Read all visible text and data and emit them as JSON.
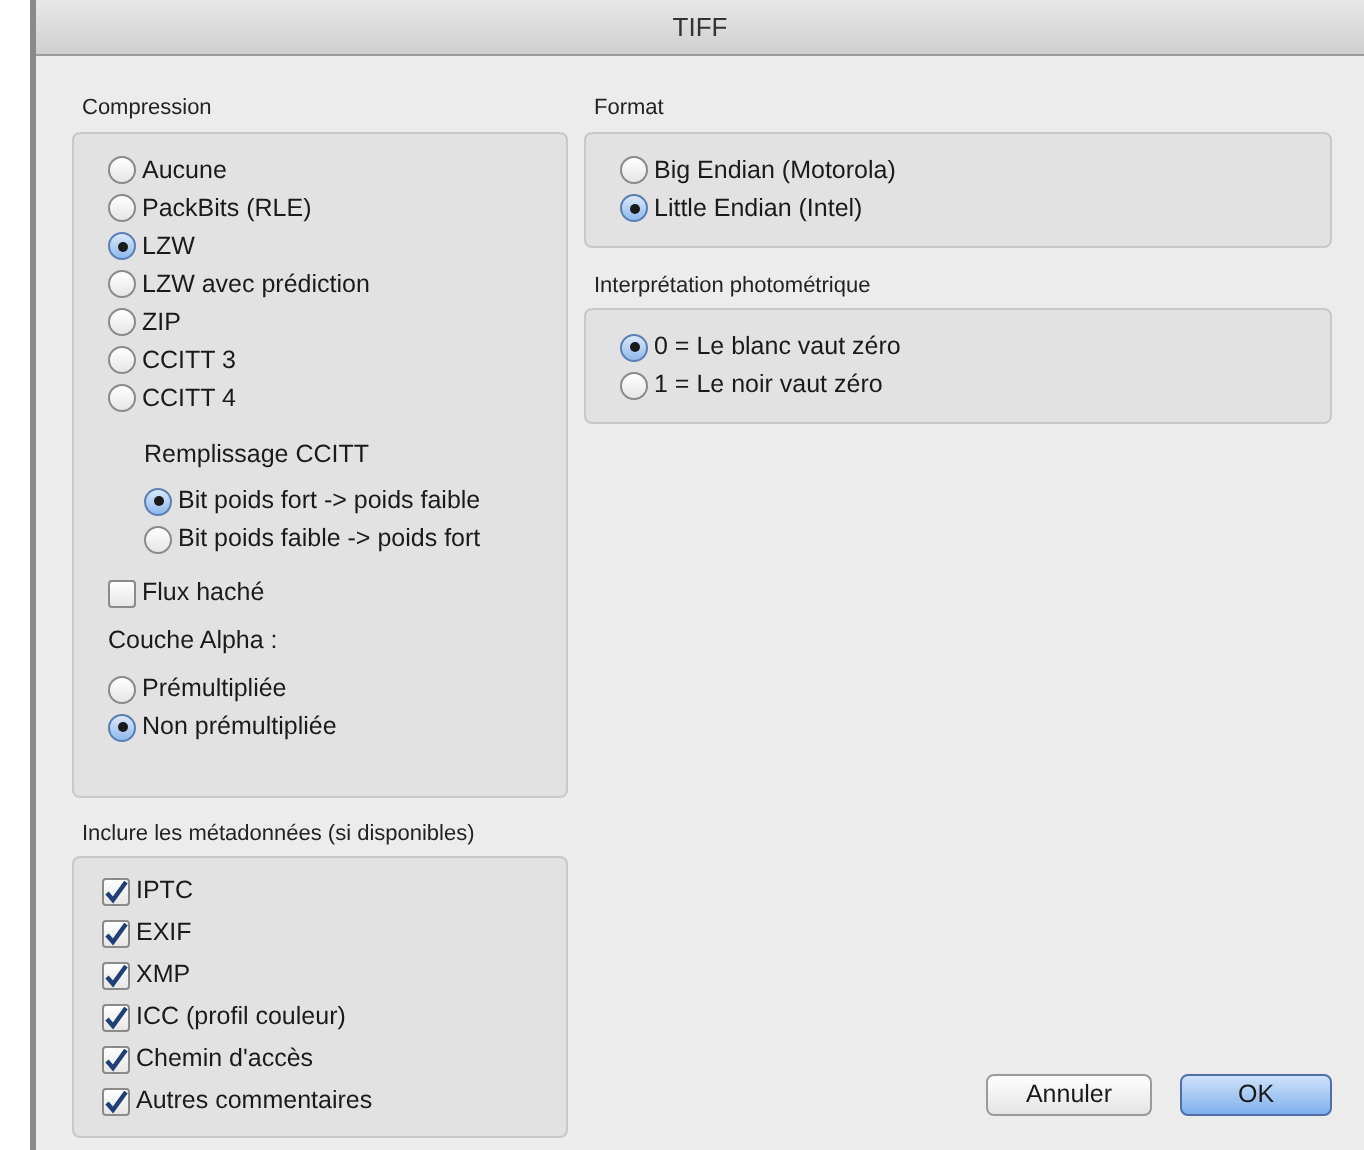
{
  "window": {
    "title": "TIFF"
  },
  "compression": {
    "label": "Compression",
    "options": [
      {
        "label": "Aucune",
        "selected": false
      },
      {
        "label": "PackBits (RLE)",
        "selected": false
      },
      {
        "label": "LZW",
        "selected": true
      },
      {
        "label": "LZW avec prédiction",
        "selected": false
      },
      {
        "label": "ZIP",
        "selected": false
      },
      {
        "label": "CCITT 3",
        "selected": false
      },
      {
        "label": "CCITT 4",
        "selected": false
      }
    ],
    "ccitt_fill": {
      "label": "Remplissage CCITT",
      "options": [
        {
          "label": "Bit poids fort -> poids faible",
          "selected": true
        },
        {
          "label": "Bit poids faible -> poids fort",
          "selected": false
        }
      ]
    },
    "hashed_stream": {
      "label": "Flux haché",
      "checked": false
    },
    "alpha": {
      "label": "Couche Alpha :",
      "options": [
        {
          "label": "Prémultipliée",
          "selected": false
        },
        {
          "label": "Non prémultipliée",
          "selected": true
        }
      ]
    }
  },
  "metadata": {
    "label": "Inclure les métadonnées (si disponibles)",
    "items": [
      {
        "label": "IPTC",
        "checked": true
      },
      {
        "label": "EXIF",
        "checked": true
      },
      {
        "label": "XMP",
        "checked": true
      },
      {
        "label": "ICC (profil couleur)",
        "checked": true
      },
      {
        "label": "Chemin d'accès",
        "checked": true
      },
      {
        "label": "Autres commentaires",
        "checked": true
      }
    ]
  },
  "format": {
    "label": "Format",
    "options": [
      {
        "label": "Big Endian (Motorola)",
        "selected": false
      },
      {
        "label": "Little Endian (Intel)",
        "selected": true
      }
    ]
  },
  "photometric": {
    "label": "Interprétation photométrique",
    "options": [
      {
        "label": "0 = Le blanc vaut zéro",
        "selected": true
      },
      {
        "label": "1 = Le noir vaut zéro",
        "selected": false
      }
    ]
  },
  "buttons": [
    {
      "label": "Annuler",
      "kind": "secondary"
    },
    {
      "label": "OK",
      "kind": "default"
    }
  ]
}
